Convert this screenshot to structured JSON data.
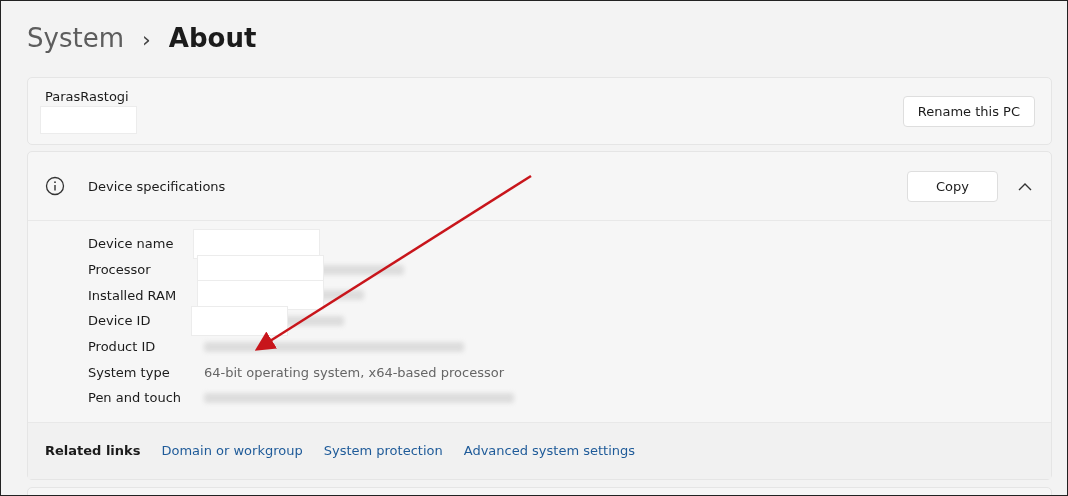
{
  "breadcrumb": {
    "parent": "System",
    "separator": "›",
    "current": "About"
  },
  "pc_card": {
    "name": "ParasRastogi",
    "name_detail": {
      "kind": "redacted"
    },
    "rename_button": "Rename this PC"
  },
  "device_specifications": {
    "title": "Device specifications",
    "copy_button": "Copy",
    "expanded": true,
    "rows": [
      {
        "label": "Device name",
        "kind": "redacted"
      },
      {
        "label": "Processor",
        "kind": "redacted"
      },
      {
        "label": "Installed RAM",
        "kind": "redacted"
      },
      {
        "label": "Device ID",
        "kind": "redacted"
      },
      {
        "label": "Product ID",
        "kind": "redacted"
      },
      {
        "label": "System type",
        "kind": "text",
        "value": "64-bit operating system, x64-based processor"
      },
      {
        "label": "Pen and touch",
        "kind": "redacted"
      }
    ],
    "related_links": {
      "label": "Related links",
      "links": [
        "Domain or workgroup",
        "System protection",
        "Advanced system settings"
      ]
    }
  }
}
